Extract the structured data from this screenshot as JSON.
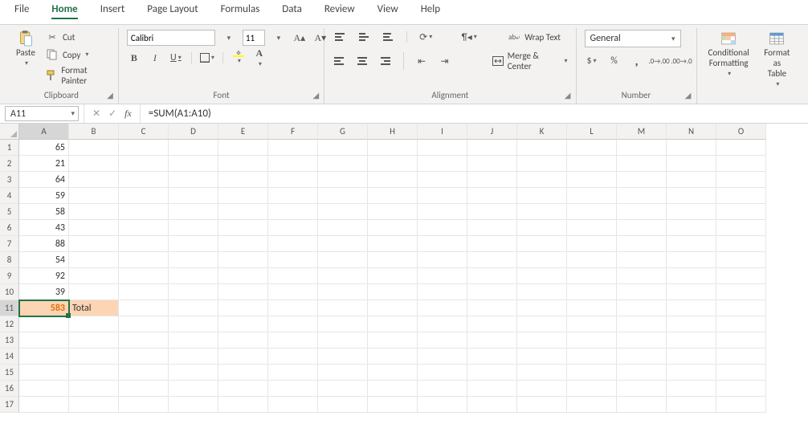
{
  "menu": {
    "items": [
      "File",
      "Home",
      "Insert",
      "Page Layout",
      "Formulas",
      "Data",
      "Review",
      "View",
      "Help"
    ],
    "active": "Home"
  },
  "ribbon": {
    "clipboard": {
      "paste": "Paste",
      "cut": "Cut",
      "copy": "Copy",
      "format_painter": "Format Painter",
      "group_label": "Clipboard"
    },
    "font": {
      "name": "Calibri",
      "size": "11",
      "bold": "B",
      "italic": "I",
      "underline": "U",
      "fill_color": "#ffff00",
      "font_color": "#c00000",
      "group_label": "Font"
    },
    "alignment": {
      "wrap": "Wrap Text",
      "merge": "Merge & Center",
      "group_label": "Alignment"
    },
    "number": {
      "format": "General",
      "group_label": "Number"
    },
    "styles": {
      "conditional": "Conditional\nFormatting",
      "format_table": "Format as\nTable"
    }
  },
  "formula_bar": {
    "name_box": "A11",
    "formula": "=SUM(A1:A10)"
  },
  "columns": [
    "A",
    "B",
    "C",
    "D",
    "E",
    "F",
    "G",
    "H",
    "I",
    "J",
    "K",
    "L",
    "M",
    "N",
    "O"
  ],
  "row_count": 17,
  "active_cell": {
    "row": 11,
    "col": "A"
  },
  "cells": {
    "A1": "65",
    "A2": "21",
    "A3": "64",
    "A4": "59",
    "A5": "58",
    "A6": "43",
    "A7": "88",
    "A8": "54",
    "A9": "92",
    "A10": "39",
    "A11": "583",
    "B11": "Total"
  },
  "cell_styles": {
    "A11": {
      "highlight": true,
      "active": true,
      "bold_orange": true,
      "align": "num"
    },
    "B11": {
      "highlight": true,
      "align": "left"
    }
  }
}
